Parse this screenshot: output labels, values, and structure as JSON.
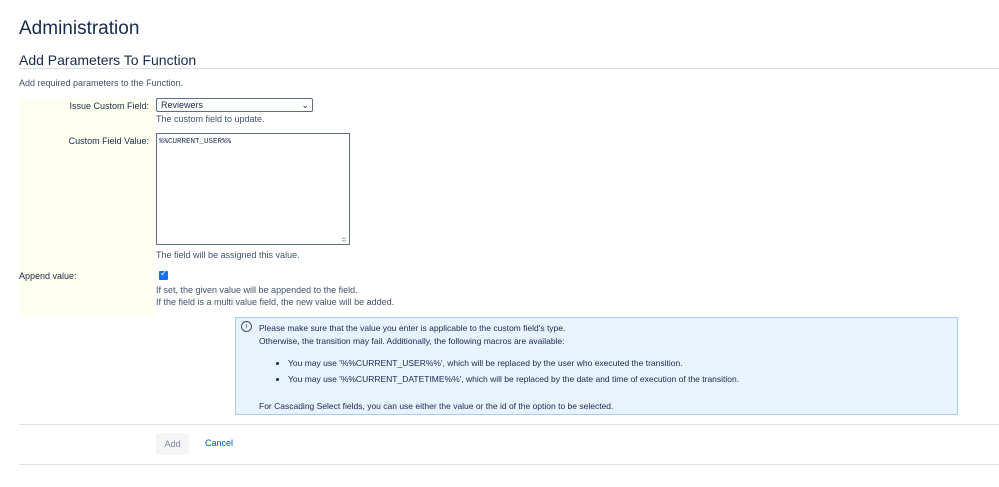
{
  "header": {
    "title": "Administration",
    "section_title": "Add Parameters To Function",
    "description": "Add required parameters to the Function."
  },
  "form": {
    "issue_custom_field": {
      "label": "Issue Custom Field:",
      "selected": "Reviewers",
      "help": "The custom field to update."
    },
    "custom_field_value": {
      "label": "Custom Field Value:",
      "value": "%%CURRENT_USER%%",
      "help": "The field will be assigned this value."
    },
    "append_value": {
      "label": "Append value:",
      "checked": true,
      "help_line1": "If set, the given value will be appended to the field.",
      "help_line2": "If the field is a multi value field, the new value will be added."
    }
  },
  "info": {
    "icon": "info-icon",
    "line1": "Please make sure that the value you enter is applicable to the custom field's type.",
    "line2": "Otherwise, the transition may fail. Additionally, the following macros are available:",
    "bullets": [
      "You may use '%%CURRENT_USER%%', which will be replaced by the user who executed the transition.",
      "You may use '%%CURRENT_DATETIME%%', which will be replaced by the date and time of execution of the transition."
    ],
    "line3": "For Cascading Select fields, you can use either the value or the id of the option to be selected."
  },
  "actions": {
    "add_label": "Add",
    "cancel_label": "Cancel"
  },
  "colors": {
    "accent": "#0052cc",
    "checkbox": "#1570ef",
    "info_background": "#e9f2ff",
    "label_background": "#fffff0"
  }
}
